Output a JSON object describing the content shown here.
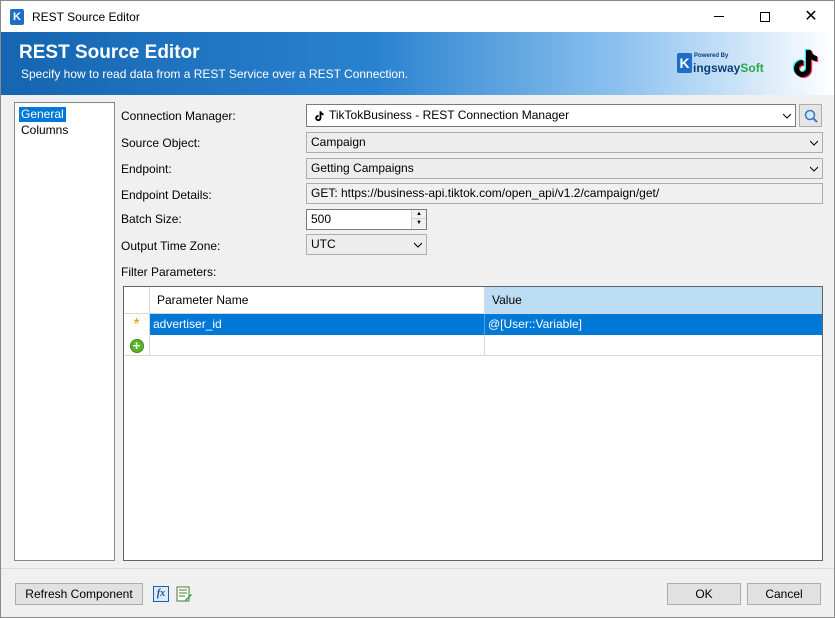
{
  "window": {
    "title": "REST Source Editor",
    "controls": {
      "minimize": "—",
      "maximize": "□",
      "close": "✕"
    }
  },
  "app_icon_letter": "K",
  "banner": {
    "title": "REST Source Editor",
    "subtitle": "Specify how to read data from a REST Service over a REST Connection.",
    "powered_by": "Powered By",
    "brand_k": "K",
    "brand_name_a": "ingsway",
    "brand_name_b": "Soft",
    "icon": "tiktok-logo-icon"
  },
  "nav": {
    "items": [
      {
        "label": "General",
        "selected": true
      },
      {
        "label": "Columns",
        "selected": false
      }
    ]
  },
  "form": {
    "connection_manager": {
      "label": "Connection Manager:",
      "value": "TikTokBusiness - REST Connection Manager"
    },
    "source_object": {
      "label": "Source Object:",
      "value": "Campaign"
    },
    "endpoint": {
      "label": "Endpoint:",
      "value": "Getting Campaigns"
    },
    "endpoint_details": {
      "label": "Endpoint Details:",
      "value": "GET: https://business-api.tiktok.com/open_api/v1.2/campaign/get/"
    },
    "batch_size": {
      "label": "Batch Size:",
      "value": "500"
    },
    "output_time_zone": {
      "label": "Output Time Zone:",
      "value": "UTC"
    },
    "filter_parameters": {
      "label": "Filter Parameters:"
    }
  },
  "grid": {
    "columns": [
      "Parameter Name",
      "Value"
    ],
    "rows": [
      {
        "marker": "*",
        "name": "advertiser_id",
        "value": "@[User::Variable]"
      }
    ]
  },
  "footer": {
    "refresh_label": "Refresh Component",
    "fx_label": "fx",
    "ok_label": "OK",
    "cancel_label": "Cancel"
  },
  "colors": {
    "accent": "#0078d7",
    "banner_start": "#1565b0",
    "header_selected": "#bcdcf4"
  }
}
